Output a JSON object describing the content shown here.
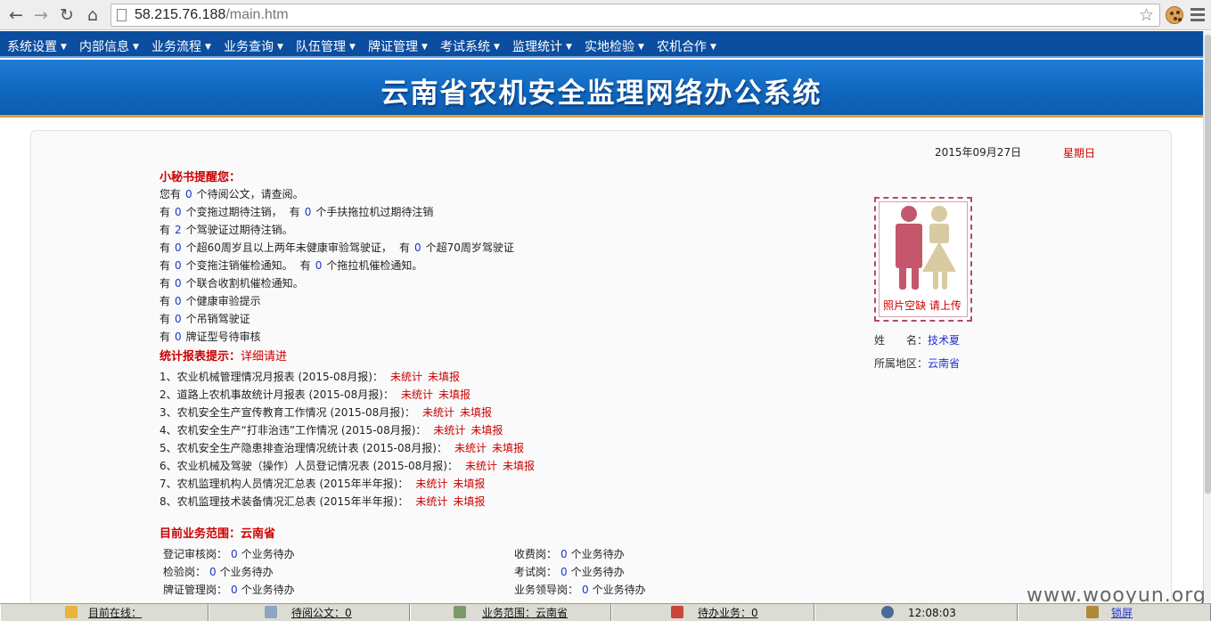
{
  "browser": {
    "url_host": "58.215.76.188",
    "url_path": "/main.htm",
    "icons": [
      "back-icon",
      "forward-icon",
      "reload-icon",
      "home-icon",
      "bookmark-star-icon",
      "cookie-icon",
      "menu-icon"
    ]
  },
  "menu": [
    {
      "label": "系统设置"
    },
    {
      "label": "内部信息"
    },
    {
      "label": "业务流程"
    },
    {
      "label": "业务查询"
    },
    {
      "label": "队伍管理"
    },
    {
      "label": "牌证管理"
    },
    {
      "label": "考试系统"
    },
    {
      "label": "监理统计"
    },
    {
      "label": "实地检验"
    },
    {
      "label": "农机合作"
    }
  ],
  "banner": {
    "title": "云南省农机安全监理网络办公系统"
  },
  "date": {
    "text": "2015年09月27日",
    "weekday": "星期日"
  },
  "reminder": {
    "heading": "小秘书提醒您：",
    "lines": [
      {
        "a": "您有",
        "n": "0",
        "b": "个待阅公文，请查阅。"
      },
      {
        "a": "有",
        "n": "0",
        "b": "个变拖过期待注销，",
        "a2": "有",
        "n2": "0",
        "b2": "个手扶拖拉机过期待注销"
      },
      {
        "a": "有",
        "n": "2",
        "b": "个驾驶证过期待注销。"
      },
      {
        "a": "有",
        "n": "0",
        "b": "个超60周岁且以上两年未健康审验驾驶证，",
        "a2": "有",
        "n2": "0",
        "b2": "个超70周岁驾驶证"
      },
      {
        "a": "有",
        "n": "0",
        "b": "个变拖注销催检通知。",
        "a2": "有",
        "n2": "0",
        "b2": "个拖拉机催检通知。"
      },
      {
        "a": "有",
        "n": "0",
        "b": "个联合收割机催检通知。"
      },
      {
        "a": "有",
        "n": "0",
        "b": "个健康审验提示"
      },
      {
        "a": "有",
        "n": "0",
        "b": "个吊销驾驶证"
      },
      {
        "a": "有",
        "n": "0",
        "b": "牌证型号待审核"
      }
    ]
  },
  "reports": {
    "heading": "统计报表提示：",
    "detail_link": "详细请进",
    "items": [
      {
        "label": "1、农业机械管理情况月报表 (2015-08月报)：",
        "s1": "未统计",
        "s2": "未填报"
      },
      {
        "label": "2、道路上农机事故统计月报表 (2015-08月报)：",
        "s1": "未统计",
        "s2": "未填报"
      },
      {
        "label": "3、农机安全生产宣传教育工作情况 (2015-08月报)：",
        "s1": "未统计",
        "s2": "未填报"
      },
      {
        "label": "4、农机安全生产“打非治违”工作情况 (2015-08月报)：",
        "s1": "未统计",
        "s2": "未填报"
      },
      {
        "label": "5、农机安全生产隐患排查治理情况统计表 (2015-08月报)：",
        "s1": "未统计",
        "s2": "未填报"
      },
      {
        "label": "6、农业机械及驾驶（操作）人员登记情况表 (2015-08月报)：",
        "s1": "未统计",
        "s2": "未填报"
      },
      {
        "label": "7、农机监理机构人员情况汇总表 (2015年半年报)：",
        "s1": "未统计",
        "s2": "未填报"
      },
      {
        "label": "8、农机监理技术装备情况汇总表 (2015年半年报)：",
        "s1": "未统计",
        "s2": "未填报"
      }
    ]
  },
  "scope": {
    "heading": "目前业务范围：云南省",
    "left": [
      {
        "a": "登记审核岗：",
        "n": "0",
        "b": "个业务待办"
      },
      {
        "a": "检验岗：",
        "n": "0",
        "b": "个业务待办"
      },
      {
        "a": "牌证管理岗：",
        "n": "0",
        "b": "个业务待办"
      }
    ],
    "right": [
      {
        "a": "收费岗：",
        "n": "0",
        "b": "个业务待办"
      },
      {
        "a": "考试岗：",
        "n": "0",
        "b": "个业务待办"
      },
      {
        "a": "业务领导岗：",
        "n": "0",
        "b": "个业务待办"
      }
    ]
  },
  "profile": {
    "photo_caption": "照片空缺 请上传",
    "name_label": "姓　　名：",
    "name": "技术夏",
    "region_label": "所属地区：",
    "region": "云南省"
  },
  "statusbar": {
    "online": "目前在线：",
    "docs": "待阅公文：0",
    "scope": "业务范围：云南省",
    "tasks": "待办业务：0",
    "time": "12:08:03",
    "lock": "锁屏"
  },
  "watermark": "www.wooyun.org"
}
